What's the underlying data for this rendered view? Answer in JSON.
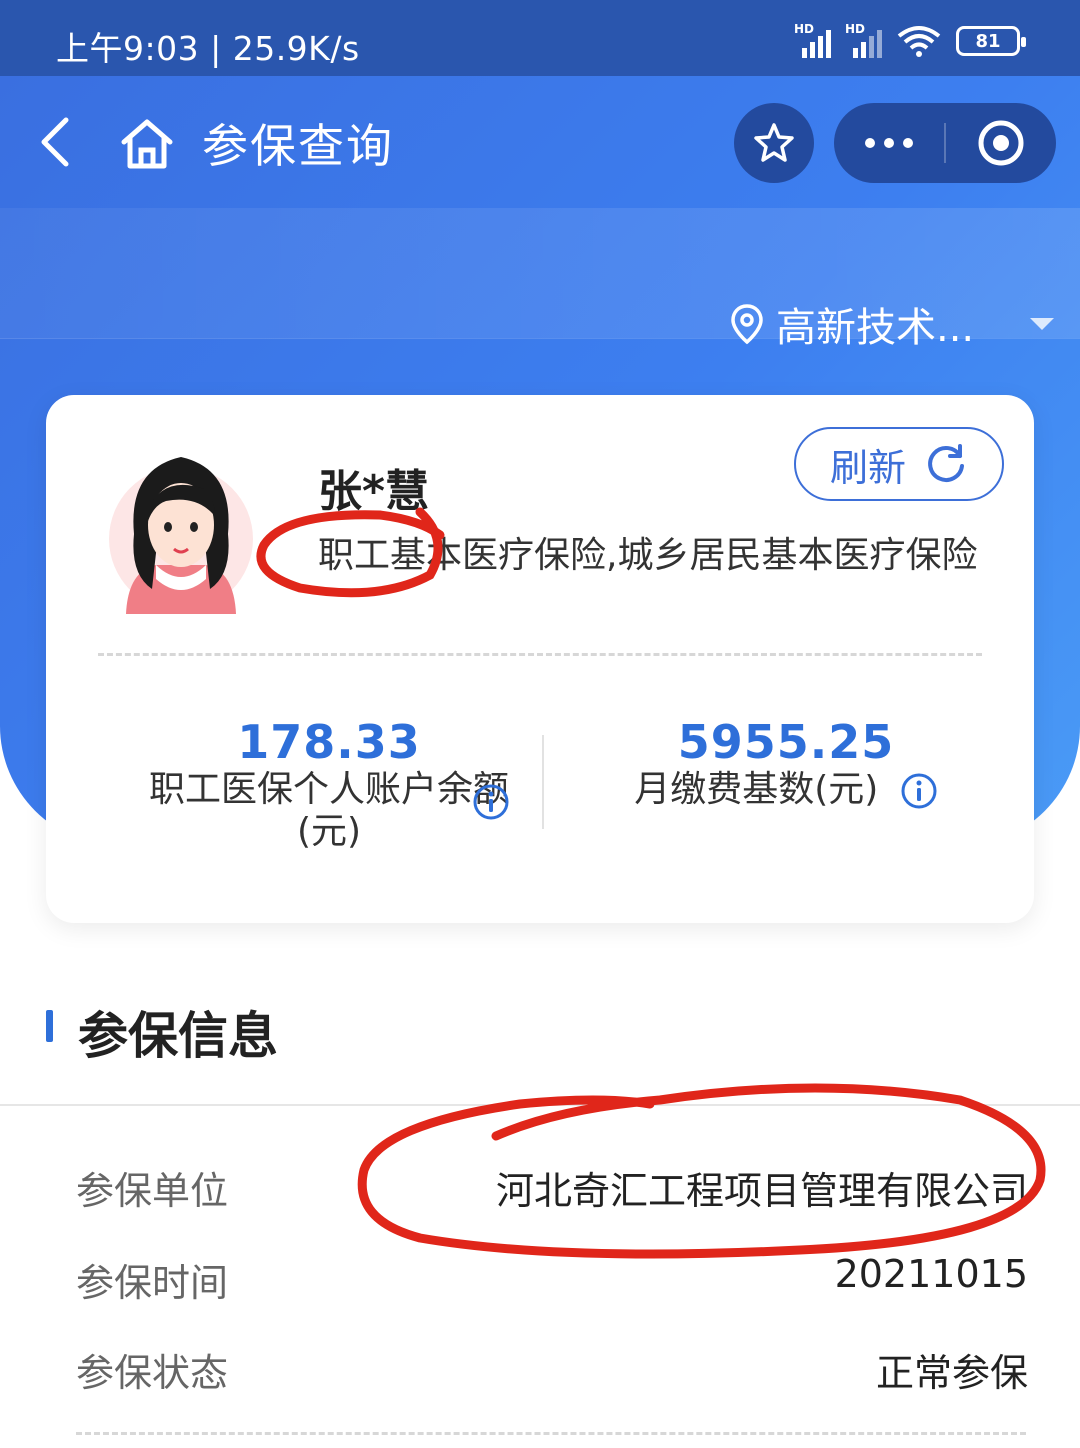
{
  "status_bar": {
    "time_speed": "上午9:03 | 25.9K/s",
    "battery": "81",
    "hd1": "HD",
    "hd2": "HD"
  },
  "nav": {
    "title": "参保查询",
    "icons": [
      "back-icon",
      "home-icon",
      "star-icon",
      "more-icon",
      "close-target-icon"
    ]
  },
  "location": {
    "text": "高新技术..."
  },
  "card": {
    "name": "张*慧",
    "insurance_types": "职工基本医疗保险,城乡居民基本医疗保险",
    "refresh_label": "刷新",
    "account_balance": {
      "value": "178.33",
      "label": "职工医保个人账户余额(元)"
    },
    "monthly_base": {
      "value": "5955.25",
      "label": "月缴费基数(元)"
    }
  },
  "section": {
    "title": "参保信息",
    "rows": [
      {
        "label": "参保单位",
        "value": "河北奇汇工程项目管理有限公司"
      },
      {
        "label": "参保时间",
        "value": "20211015"
      },
      {
        "label": "参保状态",
        "value": "正常参保"
      }
    ]
  },
  "colors": {
    "brand_blue": "#3d7ff0",
    "value_blue": "#2e6fd9",
    "annotation_red": "#e0261a"
  }
}
